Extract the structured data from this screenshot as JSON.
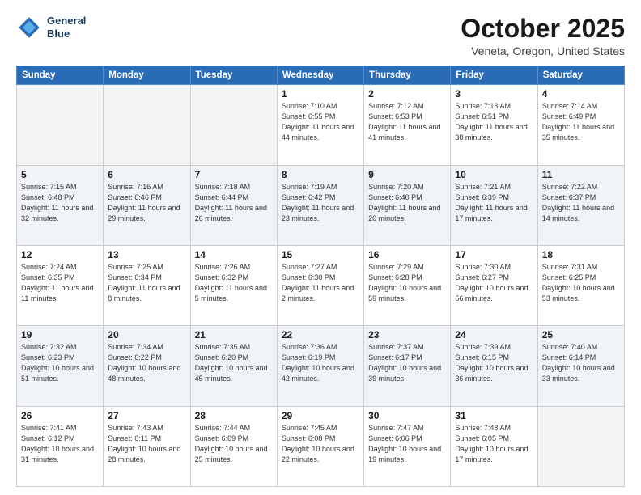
{
  "header": {
    "logo_line1": "General",
    "logo_line2": "Blue",
    "month": "October 2025",
    "location": "Veneta, Oregon, United States"
  },
  "days_of_week": [
    "Sunday",
    "Monday",
    "Tuesday",
    "Wednesday",
    "Thursday",
    "Friday",
    "Saturday"
  ],
  "weeks": [
    [
      {
        "day": "",
        "info": ""
      },
      {
        "day": "",
        "info": ""
      },
      {
        "day": "",
        "info": ""
      },
      {
        "day": "1",
        "info": "Sunrise: 7:10 AM\nSunset: 6:55 PM\nDaylight: 11 hours\nand 44 minutes."
      },
      {
        "day": "2",
        "info": "Sunrise: 7:12 AM\nSunset: 6:53 PM\nDaylight: 11 hours\nand 41 minutes."
      },
      {
        "day": "3",
        "info": "Sunrise: 7:13 AM\nSunset: 6:51 PM\nDaylight: 11 hours\nand 38 minutes."
      },
      {
        "day": "4",
        "info": "Sunrise: 7:14 AM\nSunset: 6:49 PM\nDaylight: 11 hours\nand 35 minutes."
      }
    ],
    [
      {
        "day": "5",
        "info": "Sunrise: 7:15 AM\nSunset: 6:48 PM\nDaylight: 11 hours\nand 32 minutes."
      },
      {
        "day": "6",
        "info": "Sunrise: 7:16 AM\nSunset: 6:46 PM\nDaylight: 11 hours\nand 29 minutes."
      },
      {
        "day": "7",
        "info": "Sunrise: 7:18 AM\nSunset: 6:44 PM\nDaylight: 11 hours\nand 26 minutes."
      },
      {
        "day": "8",
        "info": "Sunrise: 7:19 AM\nSunset: 6:42 PM\nDaylight: 11 hours\nand 23 minutes."
      },
      {
        "day": "9",
        "info": "Sunrise: 7:20 AM\nSunset: 6:40 PM\nDaylight: 11 hours\nand 20 minutes."
      },
      {
        "day": "10",
        "info": "Sunrise: 7:21 AM\nSunset: 6:39 PM\nDaylight: 11 hours\nand 17 minutes."
      },
      {
        "day": "11",
        "info": "Sunrise: 7:22 AM\nSunset: 6:37 PM\nDaylight: 11 hours\nand 14 minutes."
      }
    ],
    [
      {
        "day": "12",
        "info": "Sunrise: 7:24 AM\nSunset: 6:35 PM\nDaylight: 11 hours\nand 11 minutes."
      },
      {
        "day": "13",
        "info": "Sunrise: 7:25 AM\nSunset: 6:34 PM\nDaylight: 11 hours\nand 8 minutes."
      },
      {
        "day": "14",
        "info": "Sunrise: 7:26 AM\nSunset: 6:32 PM\nDaylight: 11 hours\nand 5 minutes."
      },
      {
        "day": "15",
        "info": "Sunrise: 7:27 AM\nSunset: 6:30 PM\nDaylight: 11 hours\nand 2 minutes."
      },
      {
        "day": "16",
        "info": "Sunrise: 7:29 AM\nSunset: 6:28 PM\nDaylight: 10 hours\nand 59 minutes."
      },
      {
        "day": "17",
        "info": "Sunrise: 7:30 AM\nSunset: 6:27 PM\nDaylight: 10 hours\nand 56 minutes."
      },
      {
        "day": "18",
        "info": "Sunrise: 7:31 AM\nSunset: 6:25 PM\nDaylight: 10 hours\nand 53 minutes."
      }
    ],
    [
      {
        "day": "19",
        "info": "Sunrise: 7:32 AM\nSunset: 6:23 PM\nDaylight: 10 hours\nand 51 minutes."
      },
      {
        "day": "20",
        "info": "Sunrise: 7:34 AM\nSunset: 6:22 PM\nDaylight: 10 hours\nand 48 minutes."
      },
      {
        "day": "21",
        "info": "Sunrise: 7:35 AM\nSunset: 6:20 PM\nDaylight: 10 hours\nand 45 minutes."
      },
      {
        "day": "22",
        "info": "Sunrise: 7:36 AM\nSunset: 6:19 PM\nDaylight: 10 hours\nand 42 minutes."
      },
      {
        "day": "23",
        "info": "Sunrise: 7:37 AM\nSunset: 6:17 PM\nDaylight: 10 hours\nand 39 minutes."
      },
      {
        "day": "24",
        "info": "Sunrise: 7:39 AM\nSunset: 6:15 PM\nDaylight: 10 hours\nand 36 minutes."
      },
      {
        "day": "25",
        "info": "Sunrise: 7:40 AM\nSunset: 6:14 PM\nDaylight: 10 hours\nand 33 minutes."
      }
    ],
    [
      {
        "day": "26",
        "info": "Sunrise: 7:41 AM\nSunset: 6:12 PM\nDaylight: 10 hours\nand 31 minutes."
      },
      {
        "day": "27",
        "info": "Sunrise: 7:43 AM\nSunset: 6:11 PM\nDaylight: 10 hours\nand 28 minutes."
      },
      {
        "day": "28",
        "info": "Sunrise: 7:44 AM\nSunset: 6:09 PM\nDaylight: 10 hours\nand 25 minutes."
      },
      {
        "day": "29",
        "info": "Sunrise: 7:45 AM\nSunset: 6:08 PM\nDaylight: 10 hours\nand 22 minutes."
      },
      {
        "day": "30",
        "info": "Sunrise: 7:47 AM\nSunset: 6:06 PM\nDaylight: 10 hours\nand 19 minutes."
      },
      {
        "day": "31",
        "info": "Sunrise: 7:48 AM\nSunset: 6:05 PM\nDaylight: 10 hours\nand 17 minutes."
      },
      {
        "day": "",
        "info": ""
      }
    ]
  ]
}
